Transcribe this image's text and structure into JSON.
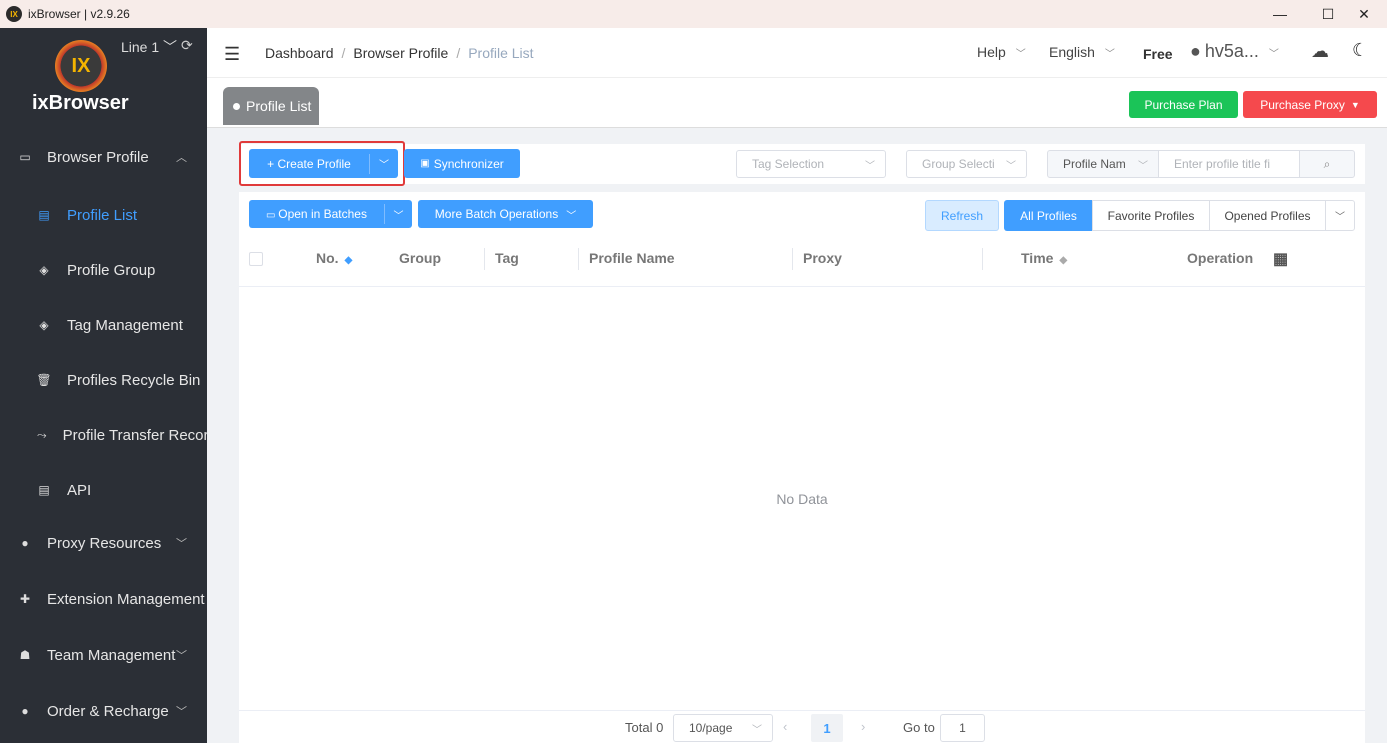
{
  "window": {
    "title": "ixBrowser | v2.9.26",
    "controls": {
      "minimize": "—",
      "maximize": "☐",
      "close": "✕"
    }
  },
  "sidebar": {
    "logo_text": "ixBrowser",
    "logo_mark": "IX",
    "line_label": "Line 1",
    "items": [
      {
        "label": "Browser Profile",
        "icon": "monitor-icon"
      },
      {
        "label": "Profile List",
        "icon": "list-icon"
      },
      {
        "label": "Profile Group",
        "icon": "layers-icon"
      },
      {
        "label": "Tag Management",
        "icon": "layers-icon"
      },
      {
        "label": "Profiles Recycle Bin",
        "icon": "trash-icon"
      },
      {
        "label": "Profile Transfer Record",
        "icon": "transfer-icon"
      },
      {
        "label": "API",
        "icon": "api-icon"
      },
      {
        "label": "Proxy Resources",
        "icon": "globe-icon"
      },
      {
        "label": "Extension Management",
        "icon": "puzzle-icon"
      },
      {
        "label": "Team Management",
        "icon": "user-icon"
      },
      {
        "label": "Order & Recharge",
        "icon": "coin-icon"
      }
    ],
    "active_color": "#409eff"
  },
  "header": {
    "breadcrumb": [
      "Dashboard",
      "Browser Profile",
      "Profile List"
    ],
    "help": "Help",
    "language": "English",
    "plan": "Free",
    "user": "hv5a..."
  },
  "tags": {
    "active_tab": "Profile List",
    "purchase_plan": "Purchase Plan",
    "purchase_proxy": "Purchase Proxy"
  },
  "toolbar": {
    "create_profile": "+ Create Profile",
    "synchronizer": "Synchronizer",
    "tag_selection_placeholder": "Tag Selection",
    "group_selection_placeholder": "Group Selecti",
    "search_field": "Profile Nam",
    "search_placeholder": "Enter profile title fi",
    "open_in_batches": "Open in Batches",
    "more_batch": "More Batch Operations",
    "refresh": "Refresh",
    "filter_tabs": [
      "All Profiles",
      "Favorite Profiles",
      "Opened Profiles"
    ]
  },
  "table": {
    "columns": [
      "No.",
      "Group",
      "Tag",
      "Profile Name",
      "Proxy",
      "Time",
      "Operation"
    ],
    "empty_text": "No Data"
  },
  "pagination": {
    "total": "Total 0",
    "page_size": "10/page",
    "current_page": "1",
    "goto_label": "Go to",
    "goto_value": "1"
  },
  "colors": {
    "primary": "#409eff",
    "success": "#1bc458",
    "danger": "#f5494d",
    "sidebar_bg": "#2b2f36",
    "highlight_border": "#e03a3a"
  }
}
